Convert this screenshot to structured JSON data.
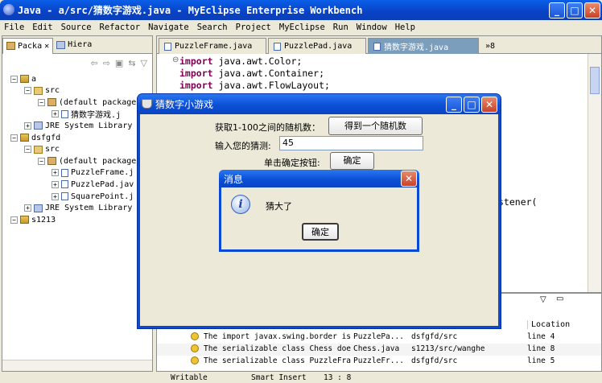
{
  "window": {
    "title": "Java - a/src/猜数字游戏.java - MyEclipse Enterprise Workbench",
    "min": "_",
    "max": "□",
    "close": "✕"
  },
  "menu": [
    "File",
    "Edit",
    "Source",
    "Refactor",
    "Navigate",
    "Search",
    "Project",
    "MyEclipse",
    "Run",
    "Window",
    "Help"
  ],
  "left_panel": {
    "tabs": [
      {
        "label": "Packa",
        "close": "✕"
      },
      {
        "label": "Hiera"
      }
    ],
    "tree": [
      {
        "label": "a",
        "depth": 0,
        "icon": "project"
      },
      {
        "label": "src",
        "depth": 1,
        "icon": "src"
      },
      {
        "label": "(default package",
        "depth": 2,
        "icon": "package"
      },
      {
        "label": "猜数字游戏.j",
        "depth": 3,
        "icon": "file"
      },
      {
        "label": "JRE System Library",
        "depth": 1,
        "icon": "library"
      },
      {
        "label": "dsfgfd",
        "depth": 0,
        "icon": "project"
      },
      {
        "label": "src",
        "depth": 1,
        "icon": "src"
      },
      {
        "label": "(default package",
        "depth": 2,
        "icon": "package"
      },
      {
        "label": "PuzzleFrame.j",
        "depth": 3,
        "icon": "file"
      },
      {
        "label": "PuzzlePad.jav",
        "depth": 3,
        "icon": "file"
      },
      {
        "label": "SquarePoint.j",
        "depth": 3,
        "icon": "file"
      },
      {
        "label": "JRE System Library",
        "depth": 1,
        "icon": "library"
      },
      {
        "label": "s1213",
        "depth": 0,
        "icon": "project"
      }
    ]
  },
  "editor": {
    "tabs": [
      {
        "label": "PuzzleFrame.java"
      },
      {
        "label": "PuzzlePad.java"
      },
      {
        "label": "猜数字游戏.java",
        "active": true
      },
      {
        "label": "»8"
      }
    ],
    "lines": [
      {
        "kw": "import",
        "rest": " java.awt.Color;"
      },
      {
        "kw": "import",
        "rest": " java.awt.Container;"
      },
      {
        "kw": "import",
        "rest": " java.awt.FlowLayout;"
      }
    ],
    "hidden_fragment": "stener("
  },
  "problems": {
    "header_location": "Location",
    "rows": [
      {
        "desc": "The import javax.swing.border is",
        "res": "PuzzlePa...",
        "path": "dsfgfd/src",
        "loc": "line 4"
      },
      {
        "desc": "The serializable class Chess doe",
        "res": "Chess.java",
        "path": "s1213/src/wanghe",
        "loc": "line 8"
      },
      {
        "desc": "The serializable class PuzzleFra",
        "res": "PuzzleFr...",
        "path": "dsfgfd/src",
        "loc": "line 5"
      }
    ]
  },
  "status": {
    "writable": "Writable",
    "insert": "Smart Insert",
    "pos": "13 : 8"
  },
  "game": {
    "title": "猜数字小游戏",
    "random_label": "获取1-100之间的随机数：",
    "random_button": "得到一个随机数",
    "guess_label": "输入您的猜测:",
    "guess_value": "45",
    "confirm_label": "单击确定按钮:",
    "confirm_button": "确定"
  },
  "message": {
    "title": "消息",
    "text": "猜大了",
    "ok": "确定",
    "close": "✕"
  }
}
